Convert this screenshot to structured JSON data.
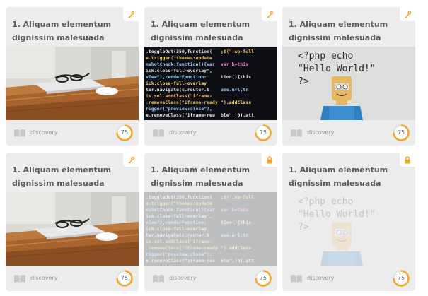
{
  "colors": {
    "card_bg": "#ececec",
    "title": "#5b5b5b",
    "badge_accent": "#f5a623",
    "progress_track": "#e2e2e2",
    "progress_fill": "#f5a623"
  },
  "cards": [
    {
      "title": "1. Aliquam elementum dignissim malesuada",
      "image": "laptop-desk",
      "badge_icon": "key-icon",
      "locked": false,
      "category": "discovery",
      "progress": 75,
      "progress_fraction": 0.75
    },
    {
      "title": "1. Aliquam elementum dignissim malesuada",
      "image": "code-screen",
      "badge_icon": "key-icon",
      "locked": false,
      "category": "discovery",
      "progress": 75,
      "progress_fraction": 0.75
    },
    {
      "title": "1. Aliquam elementum dignissim malesuada",
      "image": "hello-world",
      "badge_icon": "key-icon",
      "locked": false,
      "category": "discovery",
      "progress": 75,
      "progress_fraction": 0.75
    },
    {
      "title": "1. Aliquam elementum dignissim malesuada",
      "image": "laptop-desk",
      "badge_icon": "key-icon",
      "locked": false,
      "category": "discovery",
      "progress": 75,
      "progress_fraction": 0.75
    },
    {
      "title": "1. Aliquam elementum dignissim malesuada",
      "image": "code-screen",
      "badge_icon": "lock-icon",
      "locked": true,
      "category": "discovery",
      "progress": 75,
      "progress_fraction": 0.75
    },
    {
      "title": "1. Aliquam elementum dignissim malesuada",
      "image": "hello-world",
      "badge_icon": "lock-icon",
      "locked": true,
      "category": "discovery",
      "progress": 75,
      "progress_fraction": 0.75
    }
  ],
  "image_text": {
    "php_line1": "<?php echo",
    "php_line2": "\"Hello World!\"",
    "php_line3": "?>"
  }
}
